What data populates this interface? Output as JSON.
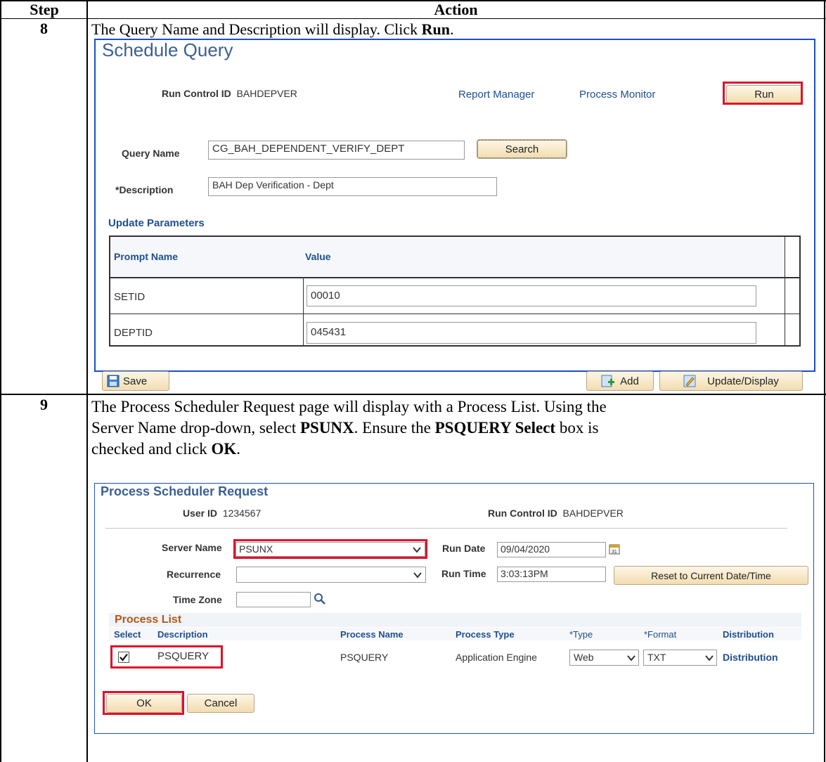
{
  "table": {
    "header_step": "Step",
    "header_action": "Action"
  },
  "step8": {
    "num": "8",
    "text_pre": "The Query Name and Description will display. Click ",
    "text_bold": "Run",
    "text_post": ".",
    "panel": {
      "title": "Schedule Query",
      "run_control_label": "Run Control ID",
      "run_control_value": "BAHDEPVER",
      "report_manager": "Report Manager",
      "process_monitor": "Process Monitor",
      "run_button": "Run",
      "query_name_label": "Query Name",
      "query_name_value": "CG_BAH_DEPENDENT_VERIFY_DEPT",
      "search_button": "Search",
      "description_label": "*Description",
      "description_value": "BAH Dep Verification - Dept",
      "update_parameters": "Update Parameters",
      "grid_headers": [
        "Prompt Name",
        "Value"
      ],
      "rows": [
        {
          "prompt": "SETID",
          "value": "00010"
        },
        {
          "prompt": "DEPTID",
          "value": "045431"
        }
      ],
      "save_button": "Save",
      "add_button": "Add",
      "update_display_button": "Update/Display"
    }
  },
  "step9": {
    "num": "9",
    "line1": "The Process Scheduler Request page will display with a Process List. Using the",
    "line2_pre": "Server Name drop-down, select ",
    "line2_b1": "PSUNX",
    "line2_mid": ". Ensure the ",
    "line2_b2": "PSQUERY Select",
    "line2_post": " box is",
    "line3_pre": "checked and click ",
    "line3_b": "OK",
    "line3_post": ".",
    "panel": {
      "title": "Process Scheduler Request",
      "user_id_label": "User ID",
      "user_id_value": "1234567",
      "run_control_label": "Run Control ID",
      "run_control_value": "BAHDEPVER",
      "server_name_label": "Server Name",
      "server_name_value": "PSUNX",
      "recurrence_label": "Recurrence",
      "recurrence_value": "",
      "time_zone_label": "Time Zone",
      "time_zone_value": "",
      "run_date_label": "Run Date",
      "run_date_value": "09/04/2020",
      "run_time_label": "Run Time",
      "run_time_value": "3:03:13PM",
      "reset_button": "Reset to Current Date/Time",
      "process_list_title": "Process List",
      "columns": [
        "Select",
        "Description",
        "Process Name",
        "Process Type",
        "*Type",
        "*Format",
        "Distribution"
      ],
      "row": {
        "selected": true,
        "description": "PSQUERY",
        "process_name": "PSQUERY",
        "process_type": "Application Engine",
        "type": "Web",
        "format": "TXT",
        "distribution": "Distribution"
      },
      "ok_button": "OK",
      "cancel_button": "Cancel"
    }
  },
  "colors": {
    "highlight": "#e0102a",
    "panel_border": "#1b4fc4",
    "button_fill": "#f3ddb0",
    "title_blue": "#3a5f95",
    "process_list_title": "#b05a17"
  },
  "icons": [
    "save-icon",
    "add-icon",
    "pencil-icon",
    "calendar-icon",
    "magnifier-icon",
    "checkbox-icon",
    "chevron-down-icon"
  ]
}
